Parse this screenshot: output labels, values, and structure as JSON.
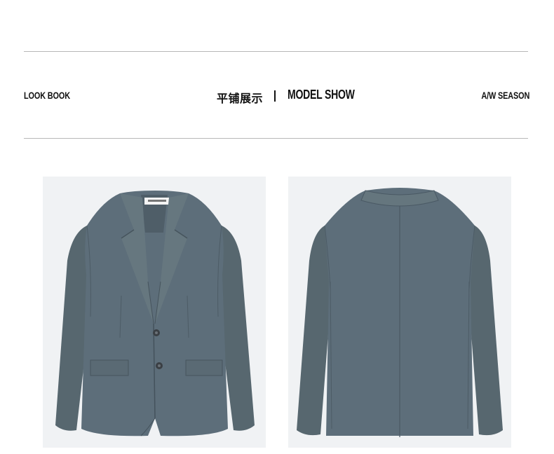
{
  "header": {
    "left_label": "LOOK BOOK",
    "cn_title": "平铺展示",
    "en_title": "MODEL SHOW",
    "right_label": "A/W SEASON"
  },
  "images": {
    "front": {
      "subject": "blazer-front"
    },
    "back": {
      "subject": "blazer-back"
    }
  },
  "colors": {
    "fabric": "#5d6e7a",
    "fabric_dark": "#4a5964",
    "fabric_shadow": "#44525c",
    "photo_bg": "#f0f2f4",
    "rule": "#b8b8b8",
    "text": "#111111"
  }
}
